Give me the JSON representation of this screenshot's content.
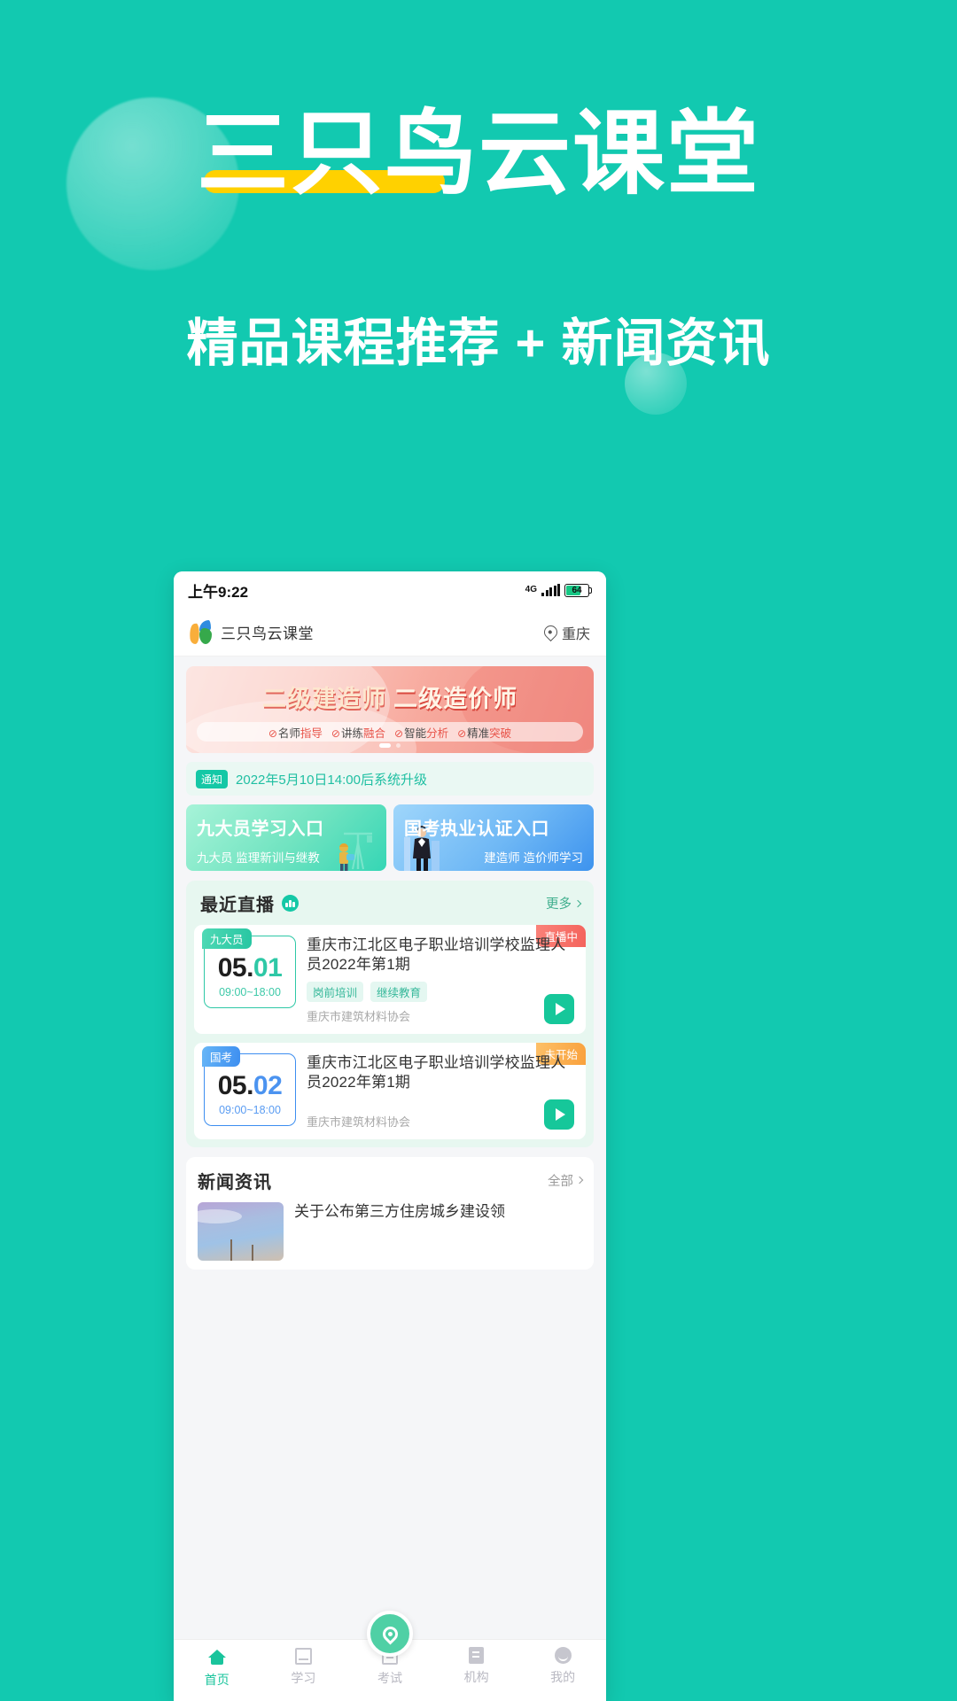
{
  "hero": {
    "title": "三只鸟云课堂",
    "subtitle": "精品课程推荐 + 新闻资讯",
    "bg_color": "#12c9b0",
    "highlight_color": "#ffd100"
  },
  "phone": {
    "status_bar": {
      "time": "上午9:22",
      "network": "4G",
      "battery_level": "64"
    },
    "app_header": {
      "brand_name": "三只鸟云课堂",
      "location": "重庆"
    },
    "banner": {
      "title_left": "二级建造师",
      "title_right": "二级造价师",
      "features": [
        {
          "plain": "名师",
          "accent": "指导"
        },
        {
          "plain": "讲练",
          "accent": "融合"
        },
        {
          "plain": "智能",
          "accent": "分析"
        },
        {
          "plain": "精准",
          "accent": "突破"
        }
      ],
      "check_icon": "check-circle-icon"
    },
    "notice": {
      "tag": "通知",
      "text": "2022年5月10日14:00后系统升级"
    },
    "entries": [
      {
        "title": "九大员学习入口",
        "subtitle": "九大员 监理新训与继教",
        "color": "#35d6b5",
        "icon": "crane-worker-icon"
      },
      {
        "title": "国考执业认证入口",
        "subtitle": "建造师 造价师学习",
        "color": "#3d93ee",
        "icon": "businessman-icon"
      }
    ],
    "live_section": {
      "title": "最近直播",
      "badge_icon": "bar-chart-icon",
      "more_label": "更多",
      "cards": [
        {
          "status": "直播中",
          "status_type": "live",
          "category": "九大员",
          "date": "05.01",
          "date_main": "05.",
          "date_accent": "01",
          "time_range": "09:00~18:00",
          "title": "重庆市江北区电子职业培训学校监理人员2022年第1期",
          "tags": [
            "岗前培训",
            "继续教育"
          ],
          "org": "重庆市建筑材料协会",
          "accent_color": "#2ec8a6"
        },
        {
          "status": "未开始",
          "status_type": "soon",
          "category": "国考",
          "date": "05.02",
          "date_main": "05.",
          "date_accent": "02",
          "time_range": "09:00~18:00",
          "title": "重庆市江北区电子职业培训学校监理人员2022年第1期",
          "tags": [],
          "org": "重庆市建筑材料协会",
          "accent_color": "#3d8ef0"
        }
      ]
    },
    "news_section": {
      "title": "新闻资讯",
      "more_label": "全部",
      "items": [
        {
          "title": "关于公布第三方住房城乡建设领"
        }
      ]
    },
    "tabbar": {
      "items": [
        {
          "label": "首页",
          "icon": "home-icon",
          "active": true
        },
        {
          "label": "学习",
          "icon": "book-icon",
          "active": false
        },
        {
          "label": "考试",
          "icon": "exam-icon",
          "active": false
        },
        {
          "label": "机构",
          "icon": "organization-icon",
          "active": false
        },
        {
          "label": "我的",
          "icon": "profile-icon",
          "active": false
        }
      ],
      "fab_icon": "location-pin-icon"
    }
  }
}
